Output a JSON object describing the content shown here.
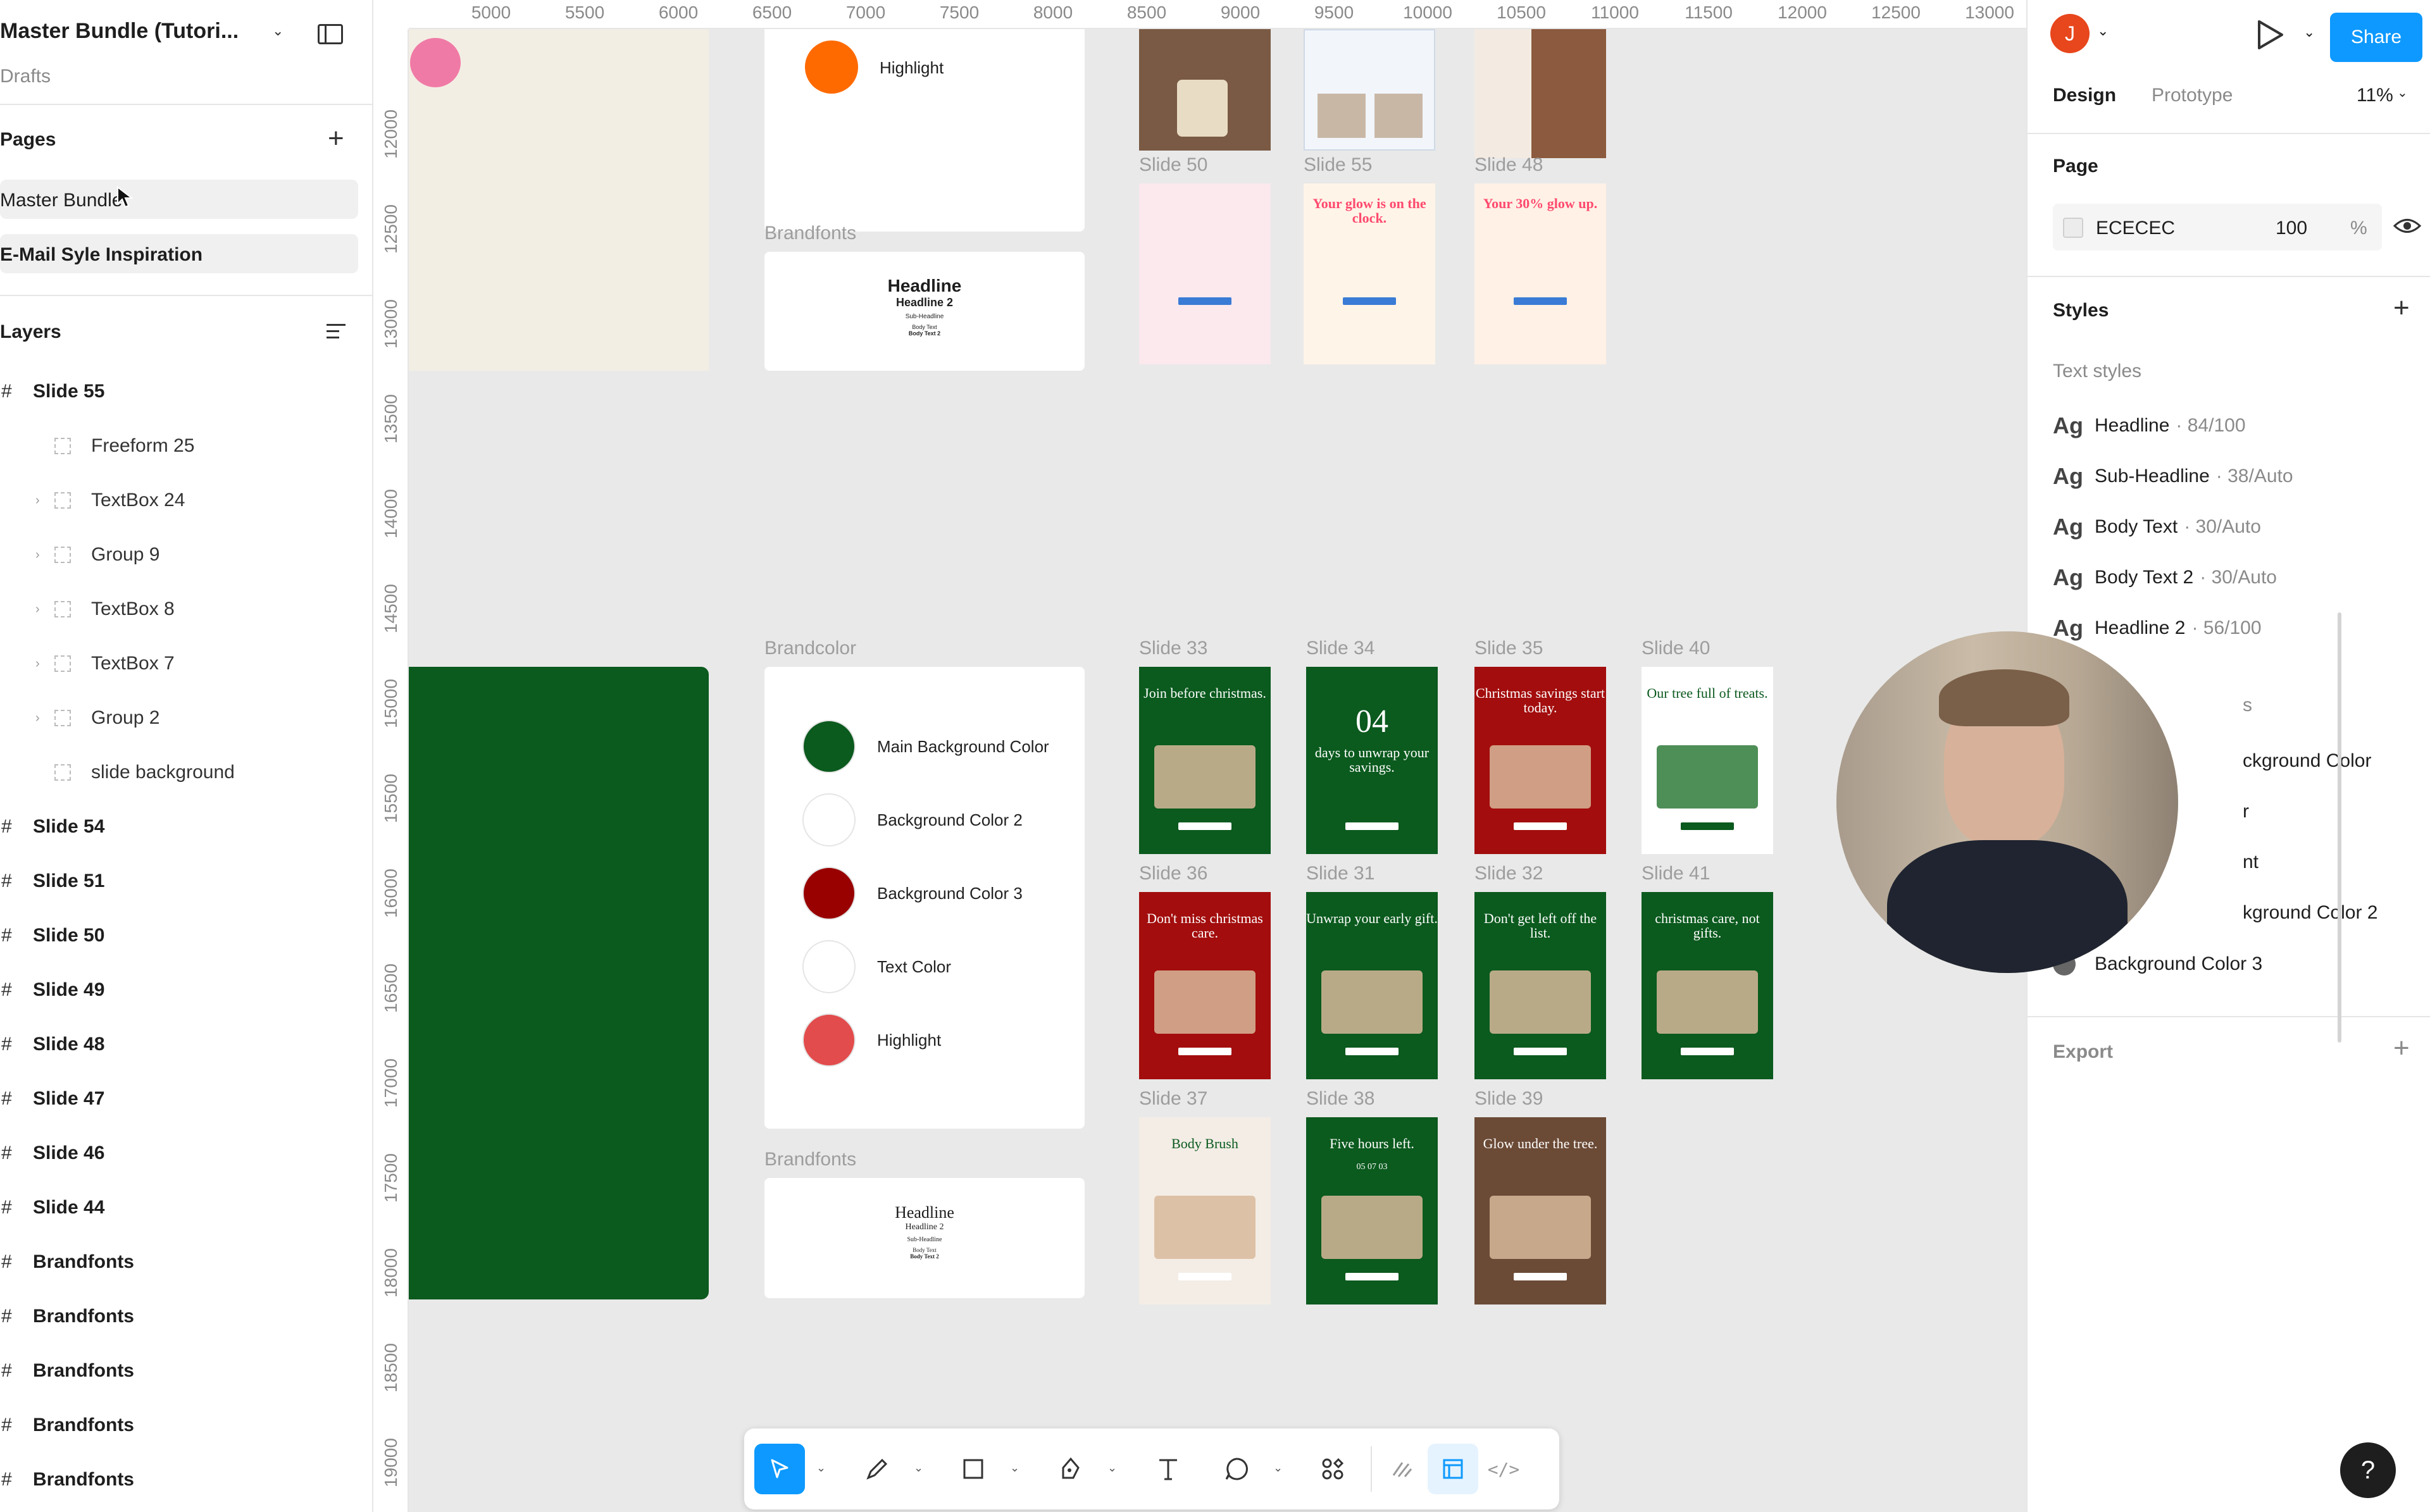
{
  "file": {
    "title": "Master Bundle (Tutori...",
    "location": "Drafts"
  },
  "pages": {
    "heading": "Pages",
    "items": [
      "Master Bundle",
      "E-Mail Syle Inspiration"
    ]
  },
  "layers": {
    "heading": "Layers",
    "items": [
      {
        "label": "Slide 55",
        "level": 0
      },
      {
        "label": "Freeform 25",
        "level": 1
      },
      {
        "label": "TextBox 24",
        "level": 1
      },
      {
        "label": "Group 9",
        "level": 1
      },
      {
        "label": "TextBox 8",
        "level": 1
      },
      {
        "label": "TextBox 7",
        "level": 1
      },
      {
        "label": "Group 2",
        "level": 1
      },
      {
        "label": "slide background",
        "level": 1
      },
      {
        "label": "Slide 54",
        "level": 0
      },
      {
        "label": "Slide 51",
        "level": 0
      },
      {
        "label": "Slide 50",
        "level": 0
      },
      {
        "label": "Slide 49",
        "level": 0
      },
      {
        "label": "Slide 48",
        "level": 0
      },
      {
        "label": "Slide 47",
        "level": 0
      },
      {
        "label": "Slide 46",
        "level": 0
      },
      {
        "label": "Slide 44",
        "level": 0
      },
      {
        "label": "Brandfonts",
        "level": 0
      },
      {
        "label": "Brandfonts",
        "level": 0
      },
      {
        "label": "Brandfonts",
        "level": 0
      },
      {
        "label": "Brandfonts",
        "level": 0
      },
      {
        "label": "Brandfonts",
        "level": 0
      }
    ]
  },
  "ruler": {
    "horizontal": [
      "5000",
      "5500",
      "6000",
      "6500",
      "7000",
      "7500",
      "8000",
      "8500",
      "9000",
      "9500",
      "10000",
      "10500",
      "11000",
      "11500",
      "12000",
      "12500",
      "13000"
    ],
    "vertical": [
      "12000",
      "12500",
      "13000",
      "13500",
      "14000",
      "14500",
      "15000",
      "15500",
      "16000",
      "16500",
      "17000",
      "17500",
      "18000",
      "18500",
      "19000"
    ]
  },
  "canvas": {
    "brandcolor_label": "Brandcolor",
    "brandfonts_label": "Brandfonts",
    "top_highlight": "Highlight",
    "top_fonts": {
      "headline": "Headline",
      "headline2": "Headline 2",
      "sub": "Sub-Headline",
      "body": "Body Text",
      "body2": "Body Text 2"
    },
    "swatches": [
      {
        "name": "Main Background Color",
        "color": "#0b5a1e"
      },
      {
        "name": "Background Color 2",
        "color": "#ffffff"
      },
      {
        "name": "Background Color 3",
        "color": "#990000"
      },
      {
        "name": "Text Color",
        "color": "#ffffff"
      },
      {
        "name": "Highlight",
        "color": "#e24c4c"
      }
    ],
    "bottom_fonts": {
      "headline": "Headline",
      "headline2": "Headline 2",
      "sub": "Sub-Headline",
      "body": "Body Text",
      "body2": "Body Text 2"
    },
    "top_slides": [
      {
        "label": "Slide 50",
        "text": ""
      },
      {
        "label": "Slide 55",
        "text": "Your glow is on the clock."
      },
      {
        "label": "Slide 48",
        "text": "Your 30% glow up."
      }
    ],
    "slides": [
      {
        "label": "Slide 33",
        "text": "Join before christmas."
      },
      {
        "label": "Slide 34",
        "text": "days to unwrap your savings."
      },
      {
        "label": "Slide 35",
        "text": "Christmas savings start today."
      },
      {
        "label": "Slide 40",
        "text": "Our tree full of treats."
      },
      {
        "label": "Slide 36",
        "text": "Don't miss christmas care."
      },
      {
        "label": "Slide 31",
        "text": "Unwrap your early gift."
      },
      {
        "label": "Slide 32",
        "text": "Don't get left off the list."
      },
      {
        "label": "Slide 41",
        "text": "christmas care, not gifts."
      },
      {
        "label": "Slide 37",
        "text": "Body Brush"
      },
      {
        "label": "Slide 38",
        "text": "Five hours left."
      },
      {
        "label": "Slide 39",
        "text": "Glow under the tree."
      }
    ],
    "counter_digits": "04",
    "timer": "05 07 03"
  },
  "toolbar": {
    "code_glyph": "</>"
  },
  "right_panel": {
    "avatar_initial": "J",
    "share_label": "Share",
    "tabs": [
      "Design",
      "Prototype"
    ],
    "zoom": "11%",
    "page_heading": "Page",
    "page_color": "ECECEC",
    "page_opacity": "100",
    "opacity_unit": "%",
    "styles_heading": "Styles",
    "text_styles_heading": "Text styles",
    "text_styles": [
      {
        "name": "Headline",
        "meta": "· 84/100"
      },
      {
        "name": "Sub-Headline",
        "meta": "· 38/Auto"
      },
      {
        "name": "Body Text",
        "meta": "· 30/Auto"
      },
      {
        "name": "Body Text 2",
        "meta": "· 30/Auto"
      },
      {
        "name": "Headline 2",
        "meta": "· 56/100"
      }
    ],
    "color_styles_partial": [
      {
        "name": "s"
      },
      {
        "name": "ckground Color"
      },
      {
        "name": "r"
      },
      {
        "name": "nt"
      },
      {
        "name": "kground Color 2"
      },
      {
        "name": "Background Color 3"
      }
    ],
    "export_heading": "Export",
    "ag": "Ag",
    "help": "?"
  },
  "colors": {
    "accent": "#0d99ff",
    "avatar": "#e8461c",
    "slide_green": "#0b5a1e",
    "slide_red": "#a30d0d"
  }
}
